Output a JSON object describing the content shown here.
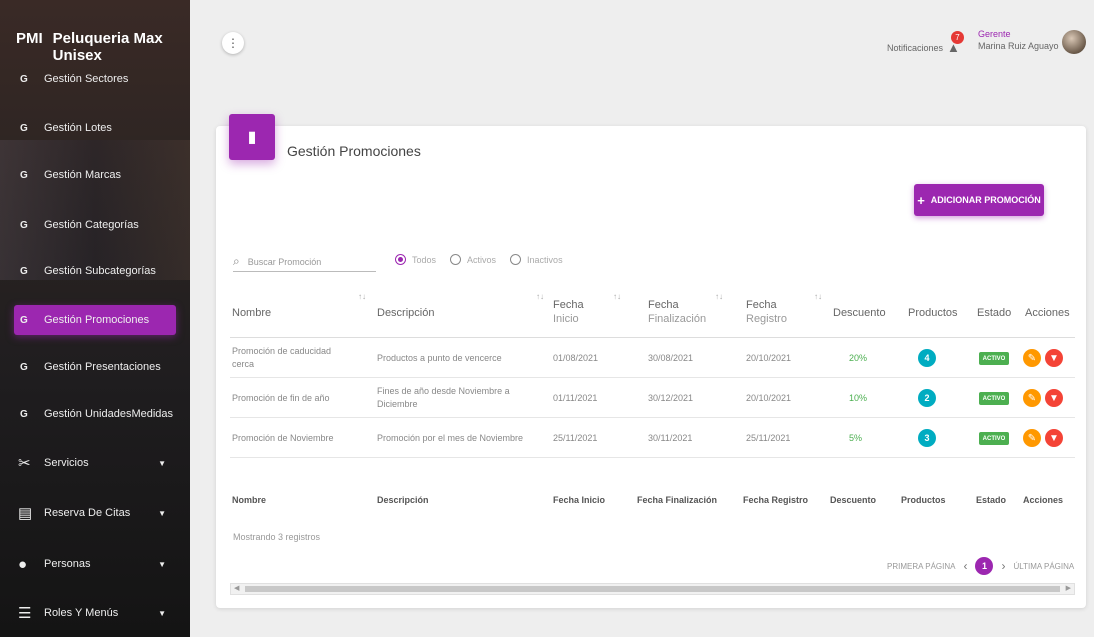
{
  "brand": {
    "abbr": "PMI",
    "name": "Peluqueria Max Unisex"
  },
  "sidebar": {
    "items": [
      {
        "abbr": "G",
        "label": "Gestión Sectores"
      },
      {
        "abbr": "G",
        "label": "Gestión Lotes"
      },
      {
        "abbr": "G",
        "label": "Gestión Marcas"
      },
      {
        "abbr": "G",
        "label": "Gestión Categorías"
      },
      {
        "abbr": "G",
        "label": "Gestión Subcategorías"
      },
      {
        "abbr": "G",
        "label": "Gestión Promociones"
      },
      {
        "abbr": "G",
        "label": "Gestión Presentaciones"
      },
      {
        "abbr": "G",
        "label": "Gestión UnidadesMedidas"
      }
    ],
    "sections": [
      {
        "icon": "scissors-icon",
        "label": "Servicios"
      },
      {
        "icon": "calendar-icon",
        "label": "Reserva De Citas"
      },
      {
        "icon": "person-icon",
        "label": "Personas"
      },
      {
        "icon": "list-icon",
        "label": "Roles Y Menús"
      }
    ]
  },
  "topbar": {
    "notifications_label": "Notificaciones",
    "notifications_count": "7",
    "user_role": "Gerente",
    "user_name": "Marina Ruiz Aguayo"
  },
  "page": {
    "title": "Gestión Promociones",
    "add_button": "ADICIONAR PROMOCIÓN",
    "search_placeholder": "Buscar Promoción",
    "filters": [
      "Todos",
      "Activos",
      "Inactivos"
    ],
    "selected_filter": "Todos"
  },
  "table": {
    "headers": {
      "nombre": "Nombre",
      "descripcion": "Descripción",
      "fecha_inicio_1": "Fecha",
      "fecha_inicio_2": "Inicio",
      "fecha_fin_1": "Fecha",
      "fecha_fin_2": "Finalización",
      "fecha_reg_1": "Fecha",
      "fecha_reg_2": "Registro",
      "descuento": "Descuento",
      "productos": "Productos",
      "estado": "Estado",
      "acciones": "Acciones"
    },
    "footer": {
      "nombre": "Nombre",
      "descripcion": "Descripción",
      "fecha_inicio": "Fecha Inicio",
      "fecha_fin": "Fecha Finalización",
      "fecha_reg": "Fecha Registro",
      "descuento": "Descuento",
      "productos": "Productos",
      "estado": "Estado",
      "acciones": "Acciones"
    },
    "rows": [
      {
        "nombre_1": "Promoción de caducidad",
        "nombre_2": "cerca",
        "desc_1": "Productos a punto de vencerce",
        "desc_2": "",
        "inicio": "01/08/2021",
        "fin": "30/08/2021",
        "registro": "20/10/2021",
        "descuento": "20%",
        "productos": "4",
        "estado": "ACTIVO"
      },
      {
        "nombre_1": "Promoción de fin de año",
        "nombre_2": "",
        "desc_1": "Fines de año desde Noviembre a",
        "desc_2": "Diciembre",
        "inicio": "01/11/2021",
        "fin": "30/12/2021",
        "registro": "20/10/2021",
        "descuento": "10%",
        "productos": "2",
        "estado": "ACTIVO"
      },
      {
        "nombre_1": "Promoción de Noviembre",
        "nombre_2": "",
        "desc_1": "Promoción por el mes de Noviembre",
        "desc_2": "",
        "inicio": "25/11/2021",
        "fin": "30/11/2021",
        "registro": "25/11/2021",
        "descuento": "5%",
        "productos": "3",
        "estado": "ACTIVO"
      }
    ]
  },
  "summary": {
    "showing": "Mostrando 3 registros"
  },
  "pagination": {
    "first": "PRIMERA PÁGINA",
    "current": "1",
    "last": "ÚLTIMA PÁGINA"
  },
  "colors": {
    "accent": "#9c27b0",
    "success": "#4caf50",
    "info": "#00acc1",
    "warning": "#ff9800",
    "danger": "#f44336"
  }
}
